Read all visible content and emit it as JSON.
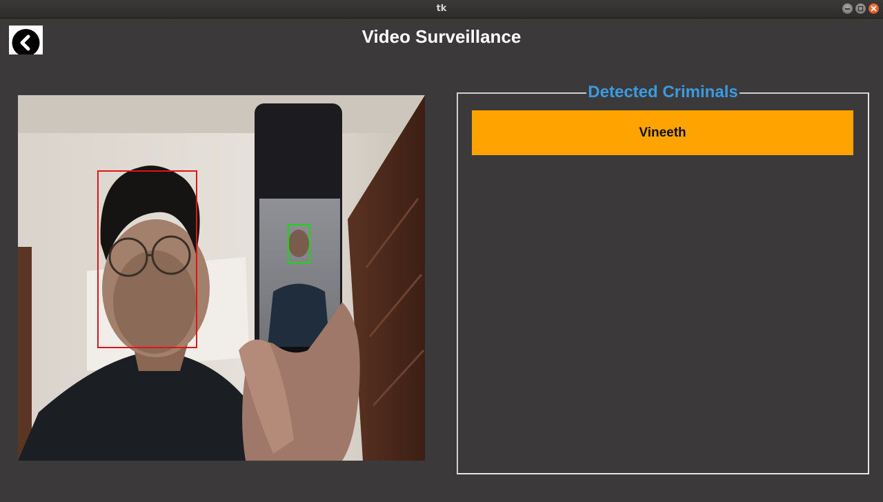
{
  "window": {
    "title": "tk",
    "controls": [
      "minimize",
      "maximize",
      "close"
    ]
  },
  "header": {
    "back_icon": "chevron-left-icon",
    "title": "Video Surveillance"
  },
  "video": {
    "feed_type": "live-camera-feed",
    "detections": [
      {
        "box_color": "#e01414",
        "label": "detected-face"
      },
      {
        "box_color": "#19d619",
        "label": "detected-face"
      }
    ]
  },
  "panel": {
    "title": "Detected Criminals",
    "items": [
      {
        "name": "Vineeth"
      }
    ]
  },
  "colors": {
    "background": "#3b393a",
    "accent_title": "#3a9be0",
    "item_highlight": "#ffa300"
  }
}
